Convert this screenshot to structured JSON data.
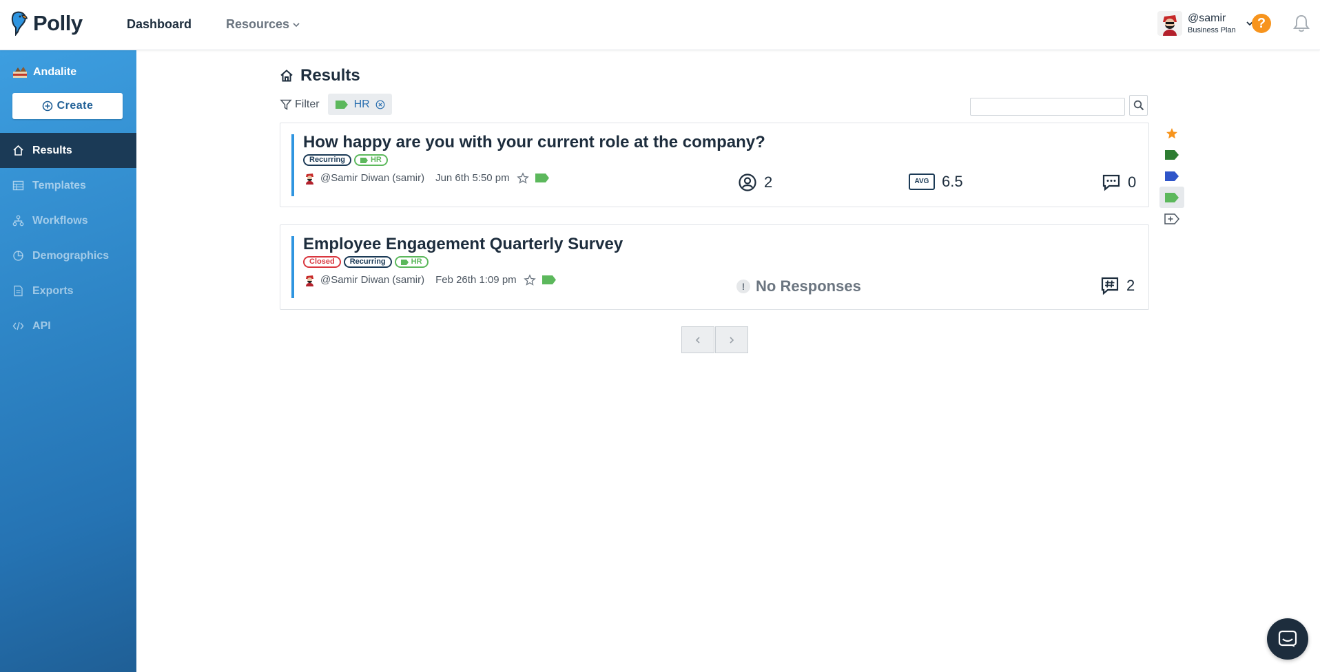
{
  "app": {
    "name": "Polly"
  },
  "topnav": {
    "dashboard": "Dashboard",
    "resources": "Resources"
  },
  "user": {
    "handle": "@samir",
    "plan": "Business Plan"
  },
  "help": {
    "label": "?"
  },
  "sidebar": {
    "workspace": "Andalite",
    "create_label": "Create",
    "items": [
      {
        "label": "Results",
        "icon": "home-icon",
        "active": true
      },
      {
        "label": "Templates",
        "icon": "table-icon",
        "active": false
      },
      {
        "label": "Workflows",
        "icon": "workflow-icon",
        "active": false
      },
      {
        "label": "Demographics",
        "icon": "demographics-icon",
        "active": false
      },
      {
        "label": "Exports",
        "icon": "exports-icon",
        "active": false
      },
      {
        "label": "API",
        "icon": "code-icon",
        "active": false
      }
    ]
  },
  "main": {
    "title": "Results",
    "filter_label": "Filter",
    "active_filter": "HR",
    "search_placeholder": ""
  },
  "results": [
    {
      "title": "How happy are you with your current role at the company?",
      "badges": [
        "Recurring",
        "HR"
      ],
      "author": "@Samir Diwan (samir)",
      "date": "Jun 6th 5:50 pm",
      "respondents": "2",
      "avg_label": "AVG",
      "avg": "6.5",
      "comments": "0"
    },
    {
      "title": "Employee Engagement Quarterly Survey",
      "badges": [
        "Closed",
        "Recurring",
        "HR"
      ],
      "author": "@Samir Diwan (samir)",
      "date": "Feb 26th 1:09 pm",
      "no_responses": "No Responses",
      "exclaim": "!",
      "threads": "2"
    }
  ],
  "colors": {
    "accent": "#2f95e0",
    "sidebar_active": "#1b3a56",
    "tag_green": "#5cb85c",
    "tag_dark_green": "#2e7d32",
    "tag_blue": "#2f55c9",
    "star": "#f7941d",
    "closed_red": "#d9363e"
  }
}
